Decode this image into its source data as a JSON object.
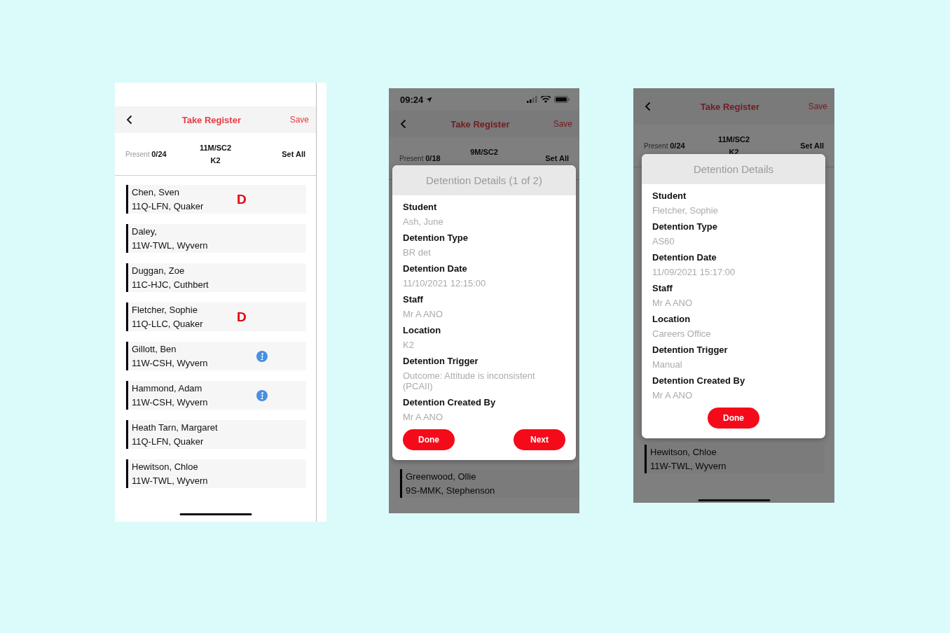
{
  "screens": [
    {
      "top_blank": true,
      "nav": {
        "title": "Take Register",
        "action": "Save"
      },
      "summary": {
        "present_label": "Present",
        "present_count": "0/24",
        "group": "11M/SC2",
        "room": "K2",
        "set_all": "Set All"
      },
      "students": [
        {
          "name": "Chen, Sven",
          "form": "11Q-LFN, Quaker",
          "marker": {
            "kind": "detention",
            "text": "D"
          }
        },
        {
          "name": "Daley,",
          "form": "11W-TWL, Wyvern"
        },
        {
          "name": "Duggan, Zoe",
          "form": "11C-HJC, Cuthbert"
        },
        {
          "name": "Fletcher, Sophie",
          "form": "11Q-LLC, Quaker",
          "marker": {
            "kind": "detention",
            "text": "D"
          }
        },
        {
          "name": "Gillott, Ben",
          "form": "11W-CSH, Wyvern",
          "marker": {
            "kind": "info"
          }
        },
        {
          "name": "Hammond, Adam",
          "form": "11W-CSH, Wyvern",
          "marker": {
            "kind": "info"
          }
        },
        {
          "name": "Heath Tarn, Margaret",
          "form": "11Q-LFN, Quaker"
        },
        {
          "name": "Hewitson, Chloe",
          "form": "11W-TWL, Wyvern"
        }
      ],
      "home_indicator": true
    },
    {
      "status_bar": {
        "time": "09:24"
      },
      "nav": {
        "title": "Take Register",
        "action": "Save"
      },
      "summary": {
        "present_label": "Present",
        "present_count": "0/18",
        "group": "9M/SC2",
        "set_all": "Set All"
      },
      "students": [
        {
          "name": "Greenwood, Ollie",
          "form": "9S-MMK, Stephenson"
        }
      ],
      "home_indicator": false,
      "dialog": {
        "title": "Detention Details (1 of 2)",
        "fields": [
          {
            "label": "Student",
            "value": "Ash, June"
          },
          {
            "label": "Detention Type",
            "value": "BR det"
          },
          {
            "label": "Detention Date",
            "value": "11/10/2021 12:15:00"
          },
          {
            "label": "Staff",
            "value": "Mr A ANO"
          },
          {
            "label": "Location",
            "value": "K2"
          },
          {
            "label": "Detention Trigger",
            "value": "Outcome: Attitude is inconsistent (PCAII)"
          },
          {
            "label": "Detention Created By",
            "value": "Mr A ANO"
          }
        ],
        "buttons": [
          "Done",
          "Next"
        ]
      }
    },
    {
      "nav": {
        "title": "Take Register",
        "action": "Save"
      },
      "summary": {
        "present_label": "Present",
        "present_count": "0/24",
        "group": "11M/SC2",
        "room": "K2",
        "set_all": "Set All"
      },
      "students": [
        {
          "name": "Hewitson, Chloe",
          "form": "11W-TWL, Wyvern"
        }
      ],
      "home_indicator": true,
      "dialog": {
        "title": "Detention Details",
        "fields": [
          {
            "label": "Student",
            "value": "Fletcher, Sophie"
          },
          {
            "label": "Detention Type",
            "value": "AS60"
          },
          {
            "label": "Detention Date",
            "value": "11/09/2021 15:17:00"
          },
          {
            "label": "Staff",
            "value": "Mr A ANO"
          },
          {
            "label": "Location",
            "value": "Careers Office"
          },
          {
            "label": "Detention Trigger",
            "value": "Manual"
          },
          {
            "label": "Detention Created By",
            "value": "Mr A ANO"
          }
        ],
        "buttons": [
          "Done"
        ]
      }
    }
  ]
}
